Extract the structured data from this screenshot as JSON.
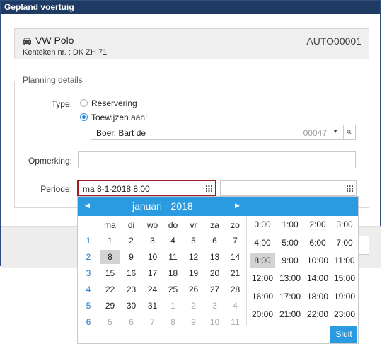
{
  "window": {
    "title": "Gepland voertuig"
  },
  "vehicle": {
    "name": "VW Polo",
    "plate": "Kenteken nr. : DK ZH 71",
    "code": "AUTO00001"
  },
  "planning": {
    "legend": "Planning details",
    "type_label": "Type:",
    "option_reserve": "Reservering",
    "option_assign": "Toewijzen aan:",
    "assign_value": "Boer, Bart de",
    "assign_code": "00047",
    "remark_label": "Opmerking:",
    "remark_value": "",
    "period_label": "Periode:",
    "period_start": "ma 8-1-2018 8:00",
    "period_end": ""
  },
  "picker": {
    "month_label": "januari - 2018",
    "weekdays": [
      "ma",
      "di",
      "wo",
      "do",
      "vr",
      "za",
      "zo"
    ],
    "weeks": [
      "1",
      "2",
      "3",
      "4",
      "5",
      "6"
    ],
    "days": [
      [
        "1",
        "2",
        "3",
        "4",
        "5",
        "6",
        "7"
      ],
      [
        "8",
        "9",
        "10",
        "11",
        "12",
        "13",
        "14"
      ],
      [
        "15",
        "16",
        "17",
        "18",
        "19",
        "20",
        "21"
      ],
      [
        "22",
        "23",
        "24",
        "25",
        "26",
        "27",
        "28"
      ],
      [
        "29",
        "30",
        "31",
        "1",
        "2",
        "3",
        "4"
      ],
      [
        "5",
        "6",
        "7",
        "8",
        "9",
        "10",
        "11"
      ]
    ],
    "hours": [
      [
        "0:00",
        "1:00",
        "2:00",
        "3:00"
      ],
      [
        "4:00",
        "5:00",
        "6:00",
        "7:00"
      ],
      [
        "8:00",
        "9:00",
        "10:00",
        "11:00"
      ],
      [
        "12:00",
        "13:00",
        "14:00",
        "15:00"
      ],
      [
        "16:00",
        "17:00",
        "18:00",
        "19:00"
      ],
      [
        "20:00",
        "21:00",
        "22:00",
        "23:00"
      ]
    ],
    "selected_day": "8",
    "selected_hour": "8:00",
    "close_label": "Sluit"
  },
  "colors": {
    "accent": "#2a9be0",
    "titlebar": "#1f3a63",
    "focus_border": "#9b1c22"
  }
}
